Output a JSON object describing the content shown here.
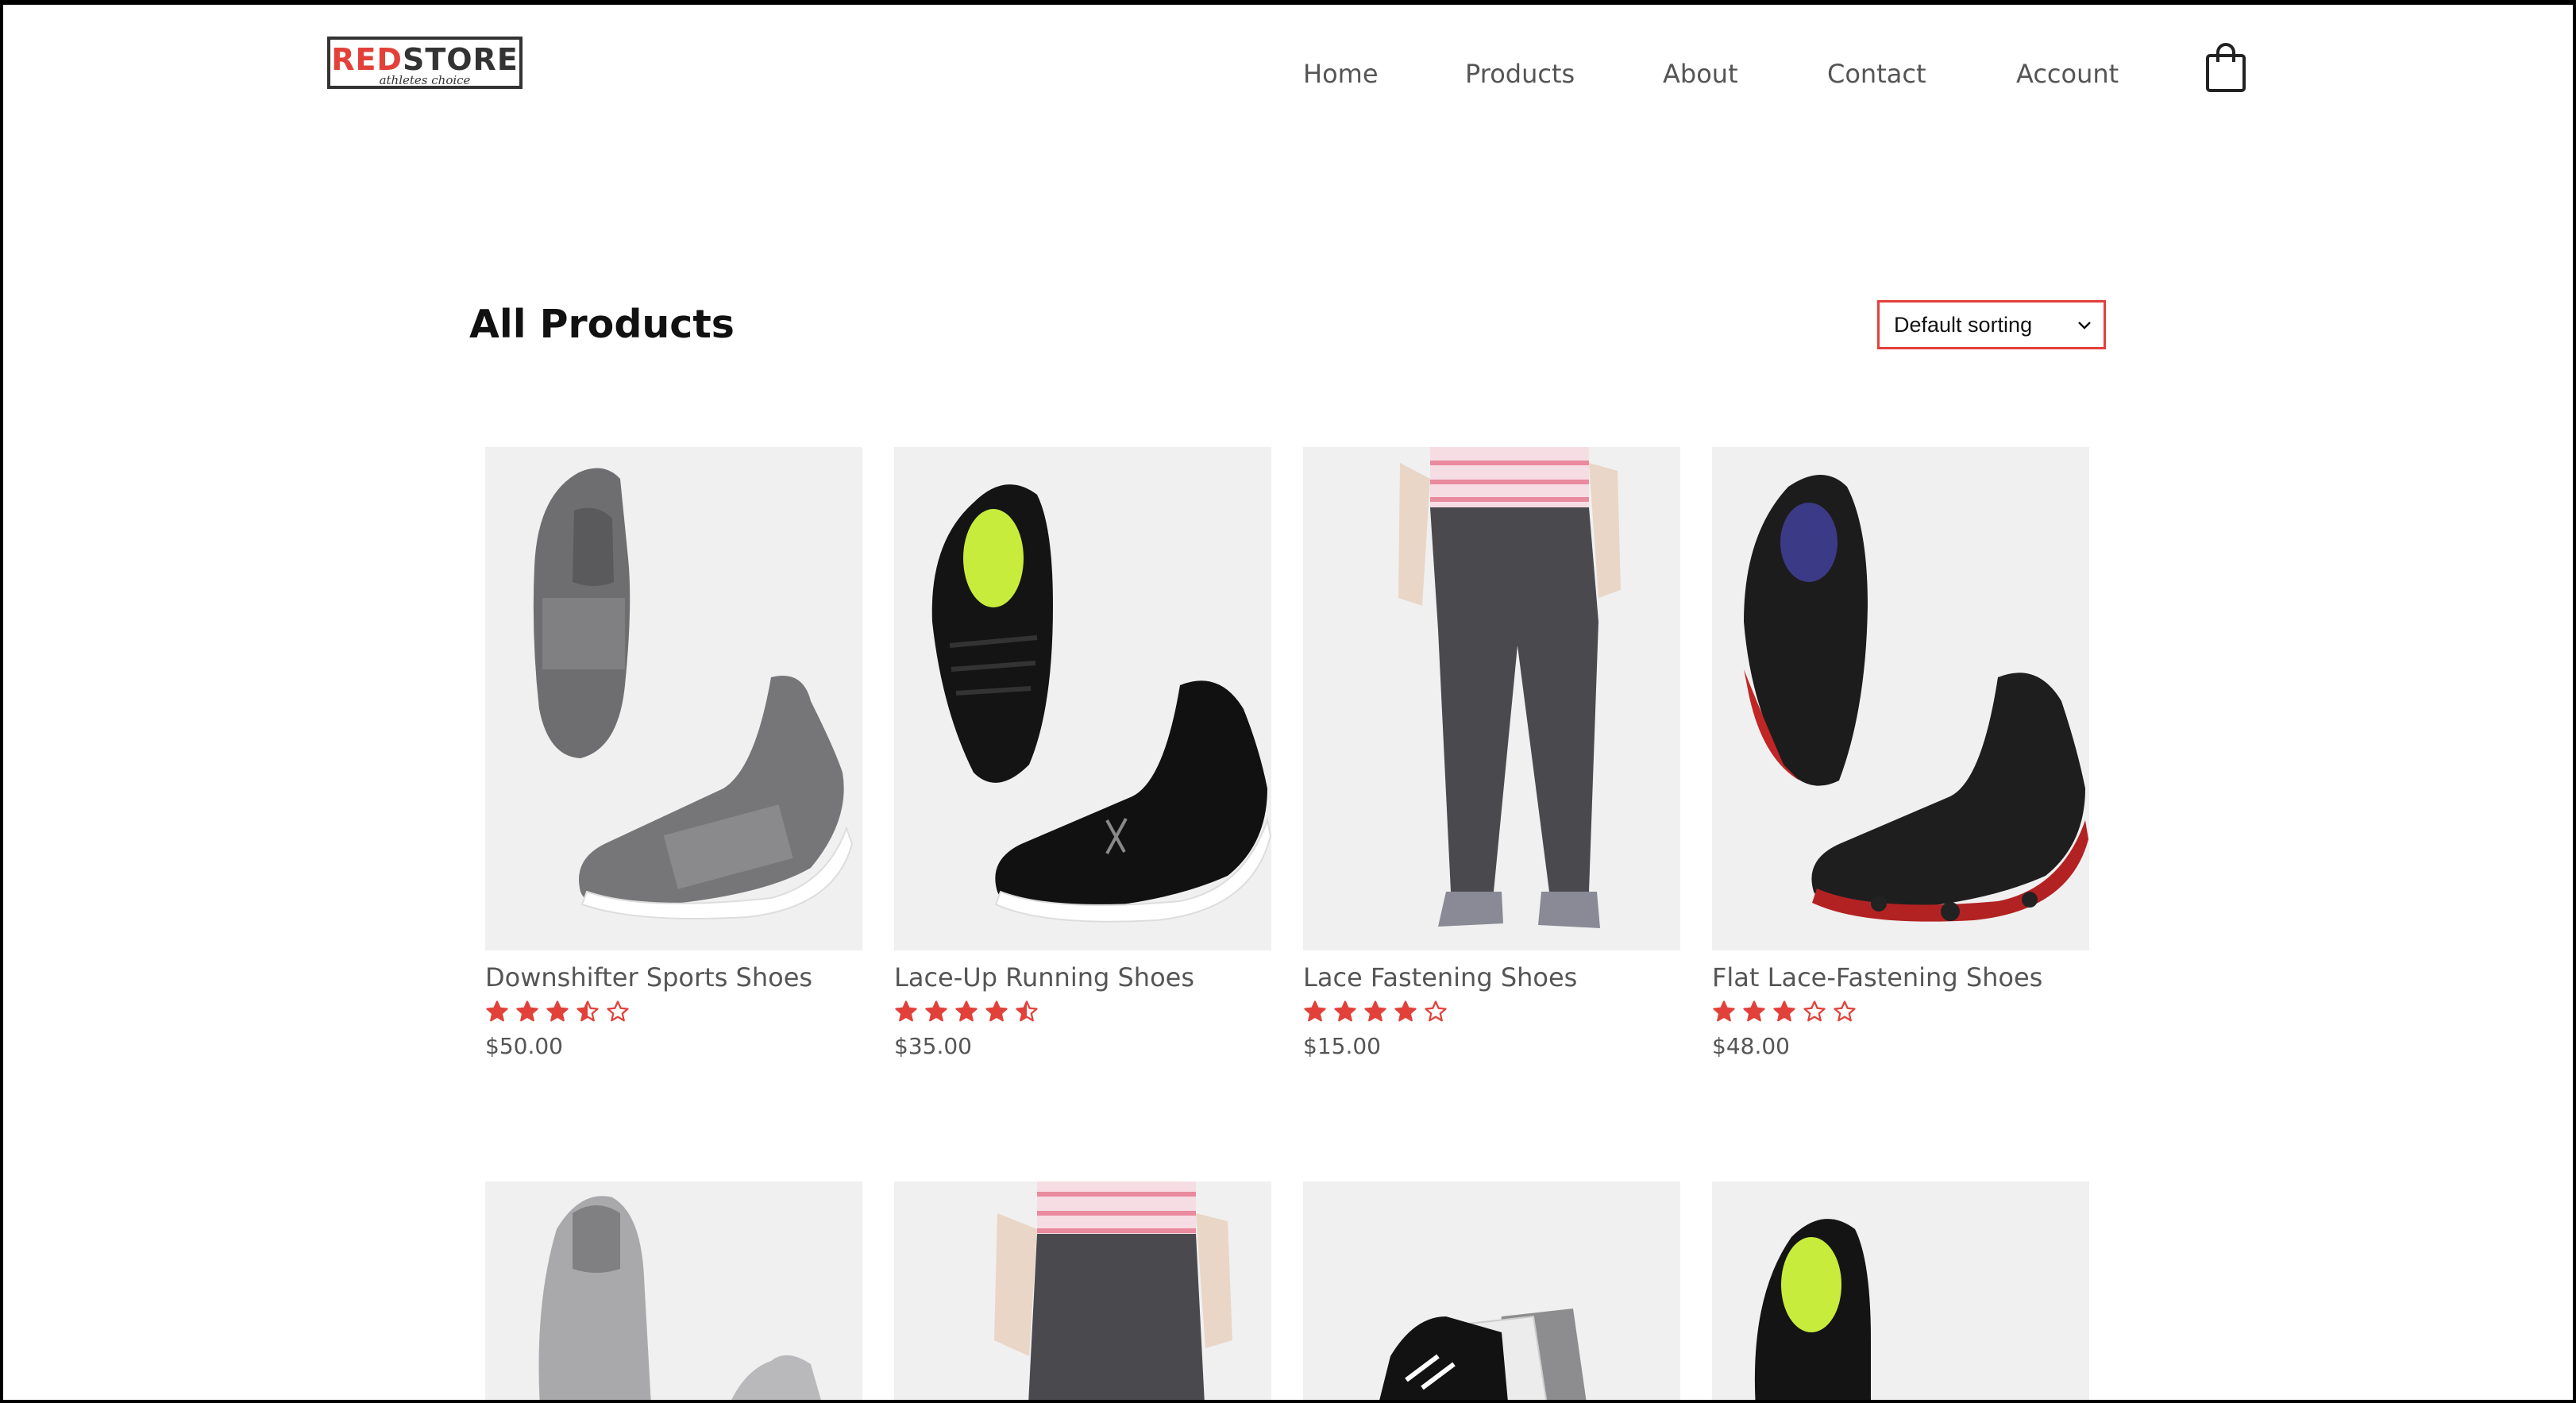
{
  "brand": {
    "logo_red": "RED",
    "logo_dark": "STORE",
    "tagline": "athletes choice"
  },
  "nav": {
    "items": [
      {
        "label": "Home"
      },
      {
        "label": "Products"
      },
      {
        "label": "About"
      },
      {
        "label": "Contact"
      },
      {
        "label": "Account"
      }
    ],
    "cart_icon": "shopping-bag-icon"
  },
  "page": {
    "title": "All Products"
  },
  "sort": {
    "selected": "Default sorting"
  },
  "colors": {
    "accent": "#e2413a",
    "text": "#555555",
    "title": "#111111",
    "image_bg": "#f0f0f0"
  },
  "products": [
    {
      "name": "Downshifter Sports Shoes",
      "rating": 3.5,
      "price": "$50.00",
      "image": "grey slip-on sneakers"
    },
    {
      "name": "Lace-Up Running Shoes",
      "rating": 4.5,
      "price": "$35.00",
      "image": "black running shoes"
    },
    {
      "name": "Lace Fastening Shoes",
      "rating": 4,
      "price": "$15.00",
      "image": "grey track pants"
    },
    {
      "name": "Flat Lace-Fastening Shoes",
      "rating": 3,
      "price": "$48.00",
      "image": "black shoes red sole"
    }
  ],
  "products_row2": [
    {
      "image": "grey high-top shoes"
    },
    {
      "image": "grey track pants"
    },
    {
      "image": "ankle socks"
    },
    {
      "image": "black running shoes"
    }
  ]
}
